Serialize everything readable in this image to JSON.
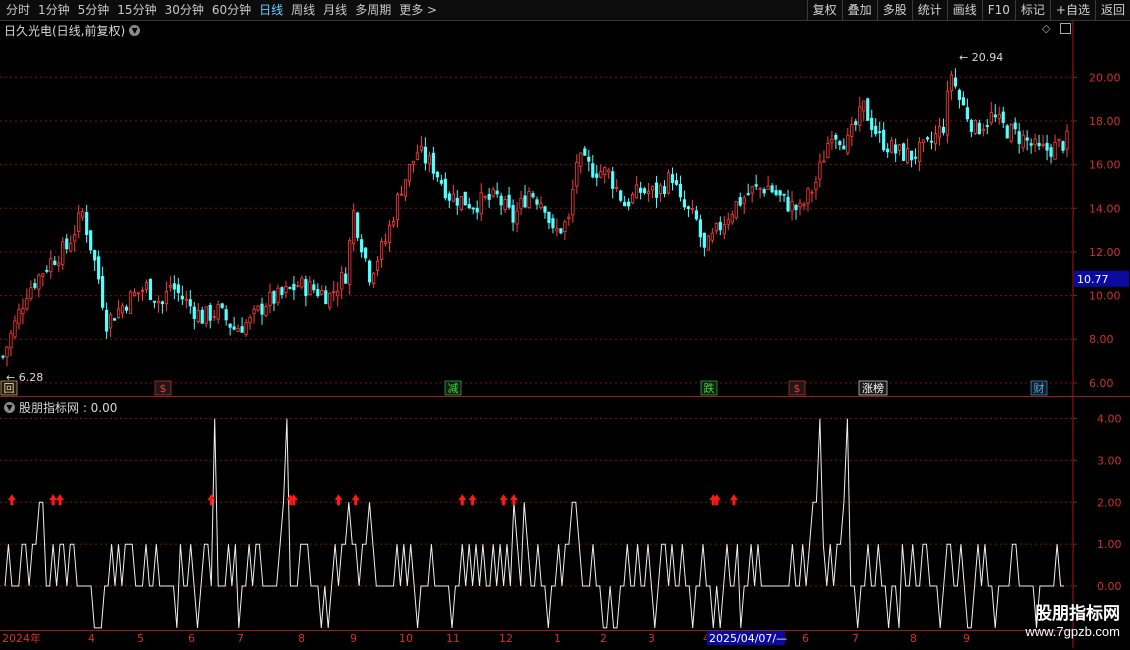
{
  "toolbar": {
    "periods": [
      {
        "label": "分时"
      },
      {
        "label": "1分钟"
      },
      {
        "label": "5分钟"
      },
      {
        "label": "15分钟"
      },
      {
        "label": "30分钟"
      },
      {
        "label": "60分钟"
      },
      {
        "label": "日线",
        "active": true
      },
      {
        "label": "周线"
      },
      {
        "label": "月线"
      },
      {
        "label": "多周期"
      },
      {
        "label": "更多 >"
      }
    ],
    "buttons": [
      {
        "label": "复权"
      },
      {
        "label": "叠加"
      },
      {
        "label": "多股"
      },
      {
        "label": "统计"
      },
      {
        "label": "画线"
      },
      {
        "label": "F10"
      },
      {
        "label": "标记"
      },
      {
        "label": "+自选"
      },
      {
        "label": "返回"
      }
    ]
  },
  "price_panel": {
    "title": "日久光电(日线,前复权)"
  },
  "indicator_panel": {
    "title": "股朋指标网 : 0.00"
  },
  "watermark": {
    "line1": "股朋指标网",
    "line2": "www.7gpzb.com"
  },
  "chart_data": [
    {
      "type": "candlestick",
      "title": "日久光电(日线,前复权)",
      "y_axis_ticks": [
        "20.00",
        "18.00",
        "16.00",
        "14.00",
        "12.00",
        "10.00",
        "8.00",
        "6.00"
      ],
      "ylim": [
        5.4,
        21.8
      ],
      "high_label": "20.94",
      "low_label": "6.28",
      "current_price_label": "10.77",
      "close_path": [
        [
          0,
          7.2
        ],
        [
          6,
          10.2
        ],
        [
          12,
          11.6
        ],
        [
          16,
          12.2
        ],
        [
          20,
          13.8
        ],
        [
          24,
          10.8
        ],
        [
          26,
          8.8
        ],
        [
          32,
          9.9
        ],
        [
          36,
          10.4
        ],
        [
          40,
          9.6
        ],
        [
          42,
          10.5
        ],
        [
          46,
          9.7
        ],
        [
          50,
          9.0
        ],
        [
          54,
          9.3
        ],
        [
          58,
          8.5
        ],
        [
          62,
          8.8
        ],
        [
          66,
          9.7
        ],
        [
          70,
          10.0
        ],
        [
          74,
          10.5
        ],
        [
          78,
          10.3
        ],
        [
          82,
          10.0
        ],
        [
          86,
          11.0
        ],
        [
          88,
          13.8
        ],
        [
          92,
          11.0
        ],
        [
          96,
          12.5
        ],
        [
          100,
          15.0
        ],
        [
          104,
          16.6
        ],
        [
          108,
          15.9
        ],
        [
          112,
          14.6
        ],
        [
          118,
          14.2
        ],
        [
          124,
          14.5
        ],
        [
          128,
          13.5
        ],
        [
          132,
          14.8
        ],
        [
          136,
          14.2
        ],
        [
          138,
          12.8
        ],
        [
          142,
          13.4
        ],
        [
          144,
          16.2
        ],
        [
          148,
          15.8
        ],
        [
          152,
          15.6
        ],
        [
          156,
          14.2
        ],
        [
          160,
          14.8
        ],
        [
          164,
          14.7
        ],
        [
          168,
          15.5
        ],
        [
          170,
          14.2
        ],
        [
          174,
          13.4
        ],
        [
          176,
          12.0
        ],
        [
          180,
          13.2
        ],
        [
          184,
          14.2
        ],
        [
          188,
          14.8
        ],
        [
          192,
          15.0
        ],
        [
          196,
          14.3
        ],
        [
          200,
          13.9
        ],
        [
          204,
          15.2
        ],
        [
          208,
          17.6
        ],
        [
          212,
          17.0
        ],
        [
          216,
          18.6
        ],
        [
          220,
          17.2
        ],
        [
          224,
          16.6
        ],
        [
          228,
          16.4
        ],
        [
          232,
          16.8
        ],
        [
          236,
          17.8
        ],
        [
          238,
          20.2
        ],
        [
          240,
          19.0
        ],
        [
          244,
          17.6
        ],
        [
          248,
          18.2
        ],
        [
          252,
          17.6
        ],
        [
          256,
          17.2
        ],
        [
          260,
          16.6
        ],
        [
          264,
          16.8
        ],
        [
          267,
          17.1
        ]
      ],
      "event_markers": [
        {
          "label": "回",
          "color": "#ffd27a"
        },
        {
          "label": "$",
          "color": "#ff3030"
        },
        {
          "label": "减",
          "color": "#30e030"
        },
        {
          "label": "跌",
          "color": "#30e030"
        },
        {
          "label": "$",
          "color": "#ff3030"
        },
        {
          "label": "涨榜",
          "color": "#ffffff"
        },
        {
          "label": "财",
          "color": "#40b0ff"
        }
      ]
    },
    {
      "type": "line",
      "title": "股朋指标网 : 0.00",
      "y_axis_ticks": [
        "4.00",
        "3.00",
        "2.00",
        "1.00",
        "0.00"
      ],
      "ylim": [
        -1.05,
        4.3
      ],
      "values": [
        0,
        1,
        0,
        0,
        0,
        1,
        1,
        0,
        1,
        1,
        2,
        2,
        0,
        0,
        1,
        0,
        1,
        1,
        0,
        1,
        1,
        0,
        0,
        0,
        0,
        0,
        -1,
        -1,
        -1,
        0,
        0,
        1,
        0,
        1,
        0,
        1,
        1,
        1,
        0,
        0,
        0,
        1,
        0,
        0,
        1,
        0,
        0,
        0,
        0,
        0,
        -1,
        1,
        0,
        0,
        1,
        0,
        -1,
        0,
        1,
        1,
        0,
        4,
        0,
        0,
        0,
        1,
        0,
        1,
        -1,
        0,
        0,
        1,
        0,
        1,
        1,
        0,
        0,
        0,
        0,
        0,
        1,
        2,
        4,
        0,
        0,
        0,
        1,
        1,
        1,
        0,
        0,
        0,
        -1,
        0,
        -1,
        0,
        1,
        0,
        1,
        1,
        2,
        1,
        1,
        0,
        1,
        1,
        2,
        1,
        0,
        0,
        0,
        0,
        0,
        0,
        1,
        0,
        1,
        0,
        1,
        0,
        -1,
        0,
        0,
        0,
        1,
        0,
        0,
        0,
        0,
        0,
        -1,
        0,
        0,
        1,
        0,
        1,
        0,
        1,
        0,
        1,
        0,
        0,
        1,
        0,
        1,
        0,
        1,
        0,
        2,
        1,
        0,
        2,
        1,
        0,
        0,
        1,
        0,
        0,
        -1,
        0,
        0,
        1,
        0,
        1,
        1,
        2,
        2,
        1,
        0,
        0,
        0,
        1,
        0,
        0,
        -1,
        -1,
        0,
        -1,
        -1,
        0,
        0,
        1,
        0,
        0,
        1,
        0,
        0,
        1,
        0,
        -1,
        0,
        1,
        1,
        0,
        1,
        0,
        0,
        1,
        0,
        0,
        -1,
        0,
        0,
        1,
        0,
        0,
        -1,
        0,
        -1,
        0,
        1,
        0,
        0,
        1,
        -1,
        0,
        0,
        1,
        0,
        1,
        0,
        0,
        0,
        0,
        0,
        0,
        0,
        0,
        0,
        1,
        0,
        0,
        1,
        0,
        1,
        2,
        2,
        4,
        1,
        0,
        1,
        0,
        1,
        1,
        2,
        4,
        0,
        0,
        -1,
        0,
        0,
        1,
        0,
        0,
        1,
        0,
        0,
        -1,
        0,
        0,
        -1,
        1,
        0,
        0,
        1,
        0,
        0,
        1,
        1,
        0,
        0,
        0,
        -1,
        0,
        1,
        1,
        0,
        0,
        1,
        0,
        -1,
        -1,
        0,
        1,
        0,
        1,
        0,
        0,
        -1,
        0,
        0,
        0,
        0,
        1,
        1,
        0,
        0,
        0,
        0,
        0,
        -1,
        0,
        0,
        0,
        0,
        0,
        1,
        0,
        0
      ],
      "signal_markers": [
        2,
        14,
        16,
        60,
        83,
        84,
        97,
        102,
        133,
        136,
        145,
        148,
        206,
        207,
        212
      ],
      "x_axis_labels": [
        "2024年",
        "4",
        "5",
        "6",
        "7",
        "8",
        "9",
        "10",
        "11",
        "12",
        "1",
        "2",
        "3",
        "4",
        "2025/04/07/—",
        "6",
        "7",
        "8",
        "9"
      ]
    }
  ]
}
